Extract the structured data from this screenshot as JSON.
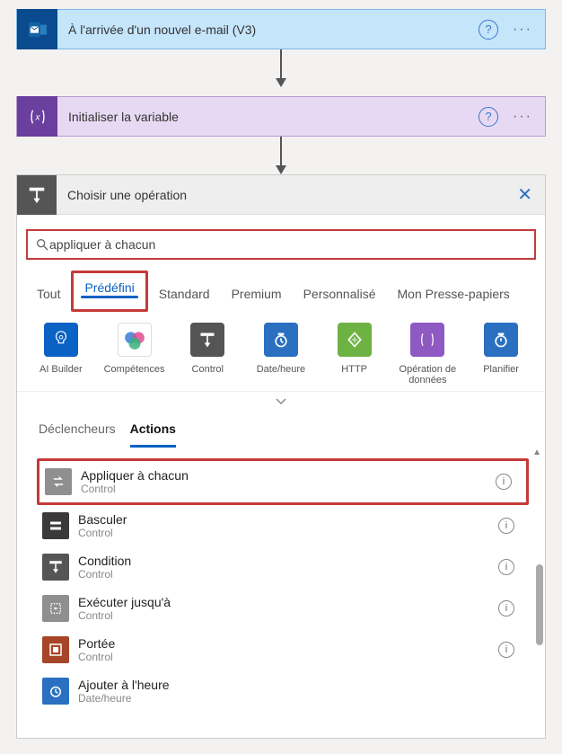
{
  "steps": [
    {
      "title": "À l'arrivée d'un nouvel e-mail (V3)"
    },
    {
      "title": "Initialiser la variable"
    }
  ],
  "op_panel": {
    "title": "Choisir une opération",
    "search_value": "appliquer à chacun",
    "category_tabs": [
      "Tout",
      "Prédéfini",
      "Standard",
      "Premium",
      "Personnalisé",
      "Mon Presse-papiers"
    ],
    "active_category": "Prédéfini",
    "connectors": [
      {
        "label": "AI Builder",
        "color": "#0a62c4"
      },
      {
        "label": "Compétences",
        "color": "#ffffff",
        "special": "copilot"
      },
      {
        "label": "Control",
        "color": "#555555"
      },
      {
        "label": "Date/heure",
        "color": "#2a6fc0"
      },
      {
        "label": "HTTP",
        "color": "#6fb244"
      },
      {
        "label": "Opération de données",
        "color": "#8e59c2"
      },
      {
        "label": "Planifier",
        "color": "#2a6fc0"
      }
    ],
    "sub_tabs": [
      "Déclencheurs",
      "Actions"
    ],
    "active_subtab": "Actions",
    "actions": [
      {
        "title": "Appliquer à chacun",
        "sub": "Control",
        "color": "#8f8f8f",
        "icon": "loop",
        "highlight": true
      },
      {
        "title": "Basculer",
        "sub": "Control",
        "color": "#3a3a3a",
        "icon": "switch"
      },
      {
        "title": "Condition",
        "sub": "Control",
        "color": "#555555",
        "icon": "condition"
      },
      {
        "title": "Exécuter jusqu'à",
        "sub": "Control",
        "color": "#8f8f8f",
        "icon": "until"
      },
      {
        "title": "Portée",
        "sub": "Control",
        "color": "#a64528",
        "icon": "scope"
      },
      {
        "title": "Ajouter à l'heure",
        "sub": "Date/heure",
        "color": "#2a6fc0",
        "icon": "clock"
      }
    ]
  }
}
